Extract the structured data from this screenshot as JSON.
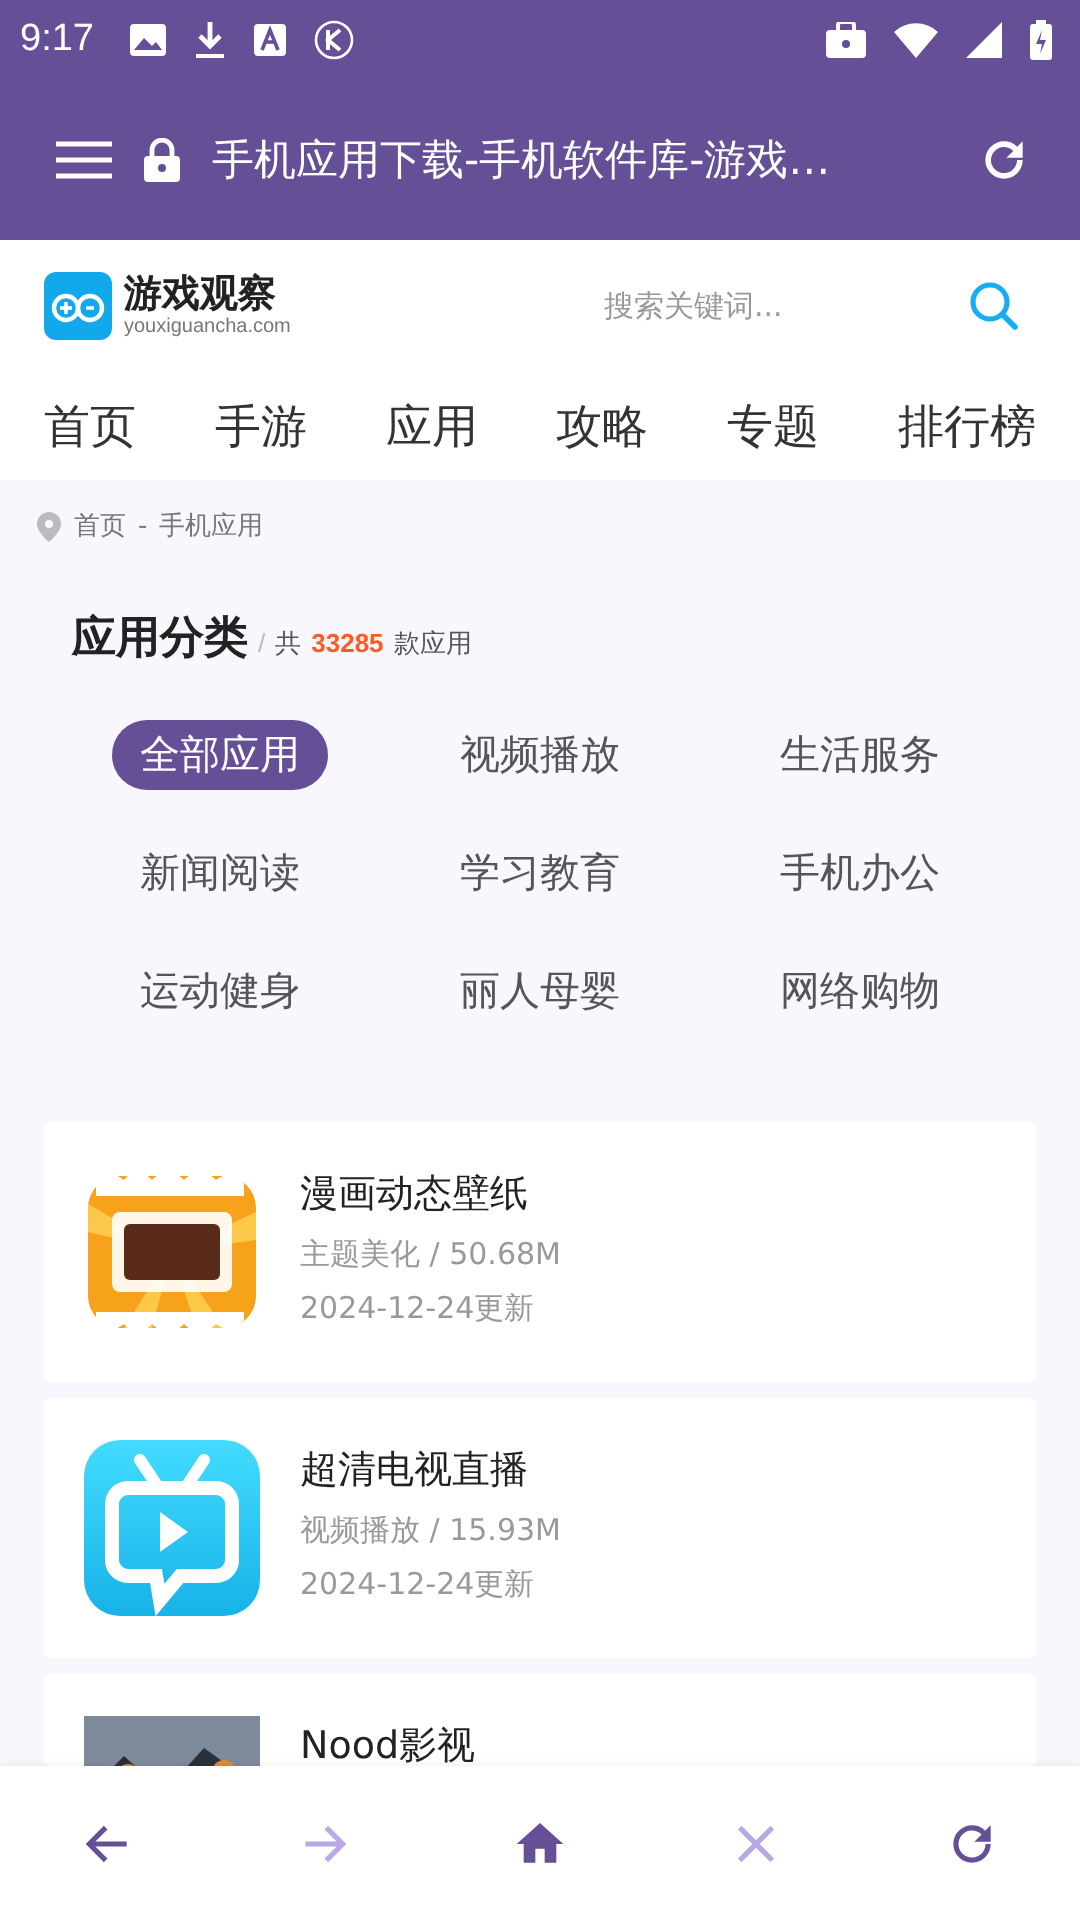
{
  "status_bar": {
    "time": "9:17"
  },
  "toolbar": {
    "title": "手机应用下载-手机软件库-游戏…"
  },
  "site": {
    "logo_name": "游戏观察",
    "logo_domain": "youxiguancha.com",
    "search": {
      "placeholder": "搜索关键词..."
    }
  },
  "nav": [
    "首页",
    "手游",
    "应用",
    "攻略",
    "专题",
    "排行榜"
  ],
  "breadcrumb": [
    "首页",
    "-",
    "手机应用"
  ],
  "section": {
    "title": "应用分类",
    "separator": "/",
    "count_prefix": "共",
    "count": "33285",
    "count_suffix": "款应用"
  },
  "categories": [
    {
      "label": "全部应用",
      "selected": true
    },
    {
      "label": "视频播放",
      "selected": false
    },
    {
      "label": "生活服务",
      "selected": false
    },
    {
      "label": "新闻阅读",
      "selected": false
    },
    {
      "label": "学习教育",
      "selected": false
    },
    {
      "label": "手机办公",
      "selected": false
    },
    {
      "label": "运动健身",
      "selected": false
    },
    {
      "label": "丽人母婴",
      "selected": false
    },
    {
      "label": "网络购物",
      "selected": false
    }
  ],
  "apps": [
    {
      "kind": "comic",
      "name": "漫画动态壁纸",
      "meta": "主题美化 / 50.68M",
      "updated": "2024-12-24更新"
    },
    {
      "kind": "tv",
      "name": "超清电视直播",
      "meta": "视频播放 / 15.93M",
      "updated": "2024-12-24更新"
    },
    {
      "kind": "picture",
      "name": "Nood影视"
    }
  ],
  "bottom_bar": [
    {
      "kind": "back",
      "disabled": false
    },
    {
      "kind": "forward",
      "disabled": true
    },
    {
      "kind": "home",
      "disabled": false
    },
    {
      "kind": "close",
      "disabled": true
    },
    {
      "kind": "refresh",
      "disabled": false
    }
  ]
}
